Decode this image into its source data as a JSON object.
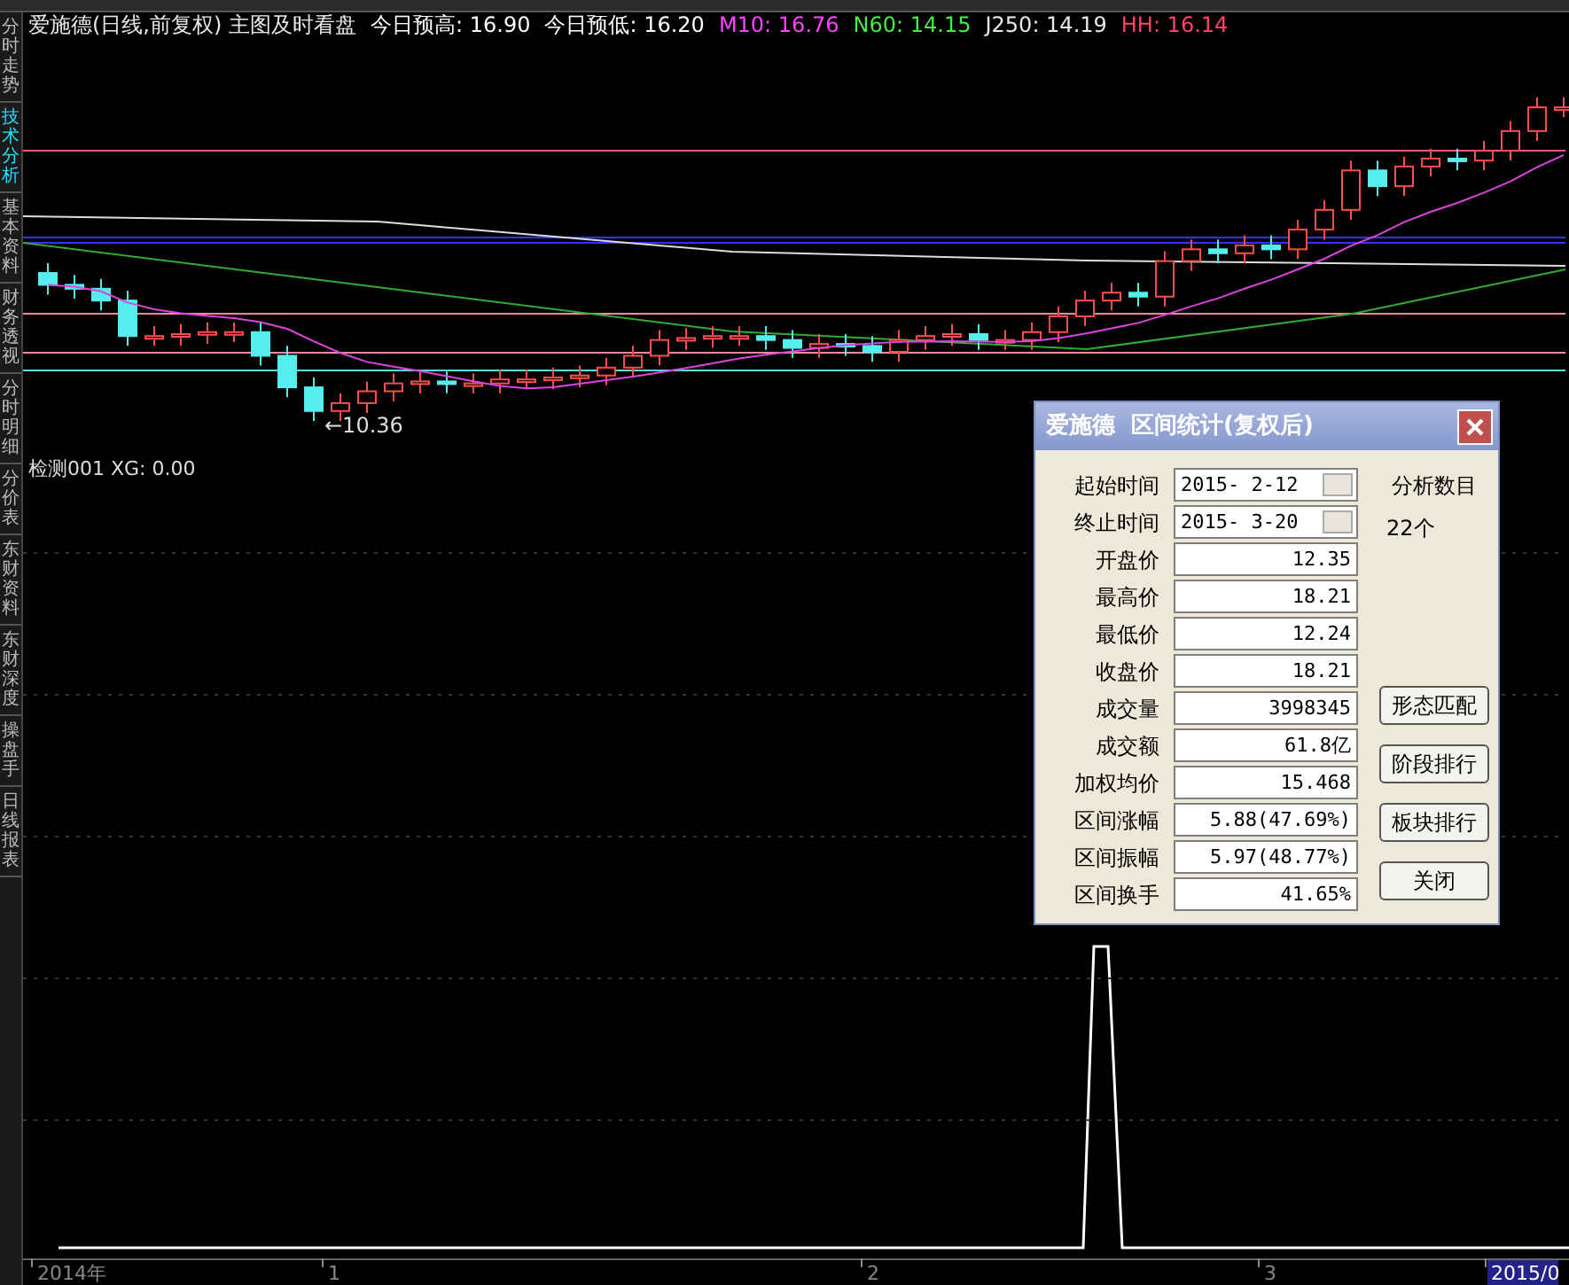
{
  "sidebar_tabs": [
    {
      "label": "分时走势",
      "selected": false
    },
    {
      "label": "技术分析",
      "selected": true
    },
    {
      "label": "基本资料",
      "selected": false
    },
    {
      "label": "财务透视",
      "selected": false
    },
    {
      "label": "分时明细",
      "selected": false
    },
    {
      "label": "分价表",
      "selected": false
    },
    {
      "label": "东财资料",
      "selected": false
    },
    {
      "label": "东财深度",
      "selected": false
    },
    {
      "label": "操盘手",
      "selected": false
    },
    {
      "label": "日线报表",
      "selected": false
    }
  ],
  "header": {
    "title": "爱施德(日线,前复权) 主图及时看盘",
    "items": [
      {
        "label": "今日预高: 16.90",
        "color": "#ffffff"
      },
      {
        "label": "今日预低: 16.20",
        "color": "#ffffff"
      },
      {
        "label": "M10: 16.76",
        "color": "#ff44ff"
      },
      {
        "label": "N60: 14.15",
        "color": "#44ee44"
      },
      {
        "label": "J250: 14.19",
        "color": "#e8e8e8"
      },
      {
        "label": "HH: 16.14",
        "color": "#ff4466"
      }
    ]
  },
  "price_chart": {
    "low_label": "←10.36"
  },
  "indicator": {
    "label": "检测001 XG: 0.00"
  },
  "time_axis": [
    {
      "label": "2014年",
      "selected": false
    },
    {
      "label": "1",
      "selected": false
    },
    {
      "label": "2",
      "selected": false
    },
    {
      "label": "3",
      "selected": false
    },
    {
      "label": "2015/0",
      "selected": true
    }
  ],
  "dialog": {
    "title": "爱施德  区间统计(复权后)",
    "date_fields": [
      {
        "label": "起始时间",
        "value": "2015- 2-12"
      },
      {
        "label": "终止时间",
        "value": "2015- 3-20"
      }
    ],
    "fields": [
      {
        "label": "开盘价",
        "value": "12.35"
      },
      {
        "label": "最高价",
        "value": "18.21"
      },
      {
        "label": "最低价",
        "value": "12.24"
      },
      {
        "label": "收盘价",
        "value": "18.21"
      },
      {
        "label": "成交量",
        "value": "3998345"
      },
      {
        "label": "成交额",
        "value": "61.8亿"
      },
      {
        "label": "加权均价",
        "value": "15.468"
      },
      {
        "label": "区间涨幅",
        "value": "5.88(47.69%)"
      },
      {
        "label": "区间振幅",
        "value": "5.97(48.77%)"
      },
      {
        "label": "区间换手",
        "value": "41.65%"
      }
    ],
    "count_label": "分析数目",
    "count": "22个",
    "buttons": [
      "形态匹配",
      "阶段排行",
      "板块排行",
      "关闭"
    ]
  }
}
